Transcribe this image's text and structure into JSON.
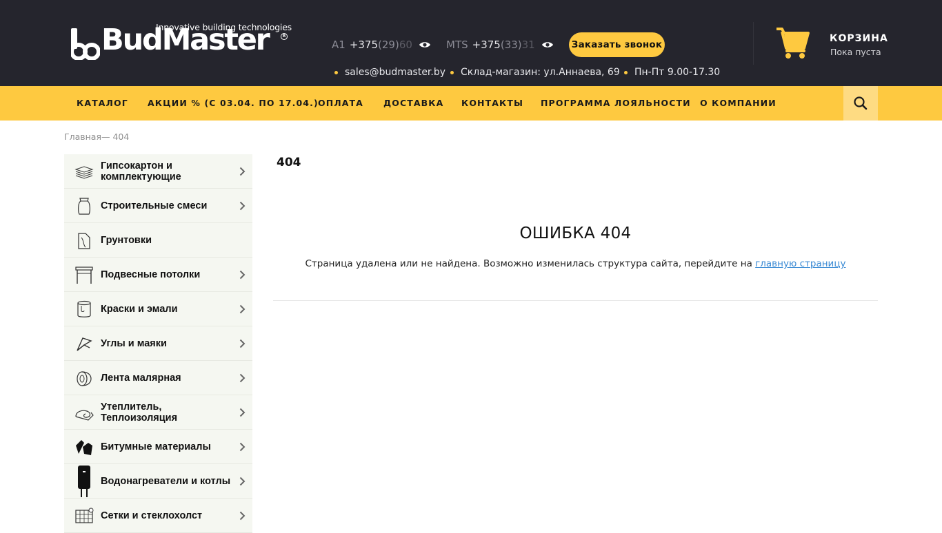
{
  "header": {
    "logo_tagline": "Innovative  building  technologies",
    "logo_word": "BudMaster",
    "logo_reg": "R",
    "phones": [
      {
        "operator": "A1",
        "main": "+375",
        "mid": "(29)",
        "tail": "60"
      },
      {
        "operator": "MTS",
        "main": "+375",
        "mid": "(33)",
        "tail": "31"
      }
    ],
    "callback_label": "Заказать звонок",
    "email": "sales@budmaster.by",
    "address": "Склад-магазин: ул.Аннаева, 69",
    "hours": "Пн-Пт 9.00-17.30",
    "cart_title": "КОРЗИНА",
    "cart_status": "Пока пуста"
  },
  "nav": {
    "items": [
      "КАТАЛОГ",
      "АКЦИИ % (С 03.04. ПО 17.04.)",
      "ОПЛАТА",
      "ДОСТАВКА",
      "КОНТАКТЫ",
      "ПРОГРАММА ЛОЯЛЬНОСТИ",
      "О КОМПАНИИ"
    ]
  },
  "breadcrumb": {
    "home": "Главная",
    "separator": "— ",
    "current": "404"
  },
  "sidebar": {
    "items": [
      {
        "label": "Гипсокартон и комплектующие",
        "icon": "drywall-sheets-icon",
        "has_children": true
      },
      {
        "label": "Строительные смеси",
        "icon": "mix-bag-icon",
        "has_children": true
      },
      {
        "label": "Грунтовки",
        "icon": "primer-canister-icon",
        "has_children": false
      },
      {
        "label": "Подвесные потолки",
        "icon": "ceiling-frame-icon",
        "has_children": true
      },
      {
        "label": "Краски и эмали",
        "icon": "paint-bucket-icon",
        "has_children": true
      },
      {
        "label": "Углы и маяки",
        "icon": "corner-profile-icon",
        "has_children": true
      },
      {
        "label": "Лента малярная",
        "icon": "tape-roll-icon",
        "has_children": true
      },
      {
        "label": "Утеплитель, Теплоизоляция",
        "icon": "insulation-roll-icon",
        "has_children": true
      },
      {
        "label": "Битумные материалы",
        "icon": "bitumen-icon",
        "has_children": true
      },
      {
        "label": "Водонагреватели и котлы",
        "icon": "water-heater-icon",
        "has_children": true
      },
      {
        "label": "Сетки и стеклохолст",
        "icon": "mesh-icon",
        "has_children": true
      }
    ]
  },
  "main": {
    "page_heading": "404",
    "error_title": "ОШИБКА 404",
    "error_text": "Страница удалена или не найдена. Возможно изменилась структура сайта, перейдите на ",
    "error_link": "главную страницу"
  },
  "colors": {
    "header_bg": "#25252d",
    "accent_yellow": "#fec940",
    "sidebar_bg": "#f5f7f1",
    "link_blue": "#3a8ad4"
  }
}
